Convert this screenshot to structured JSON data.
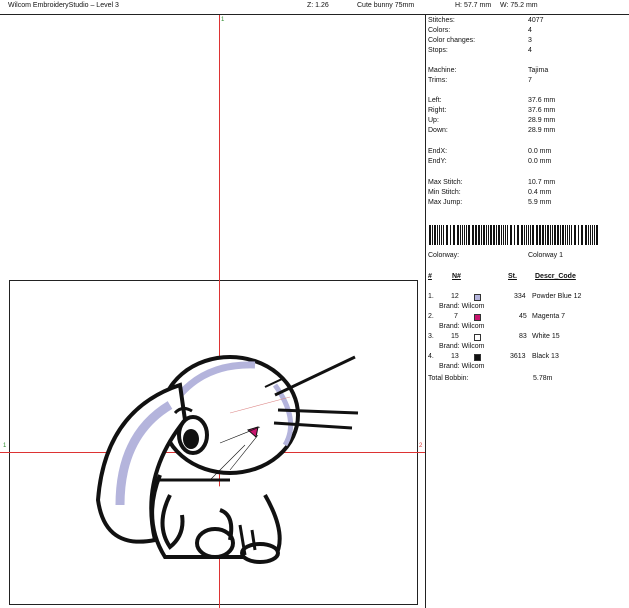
{
  "title_bar": {
    "app_title": "Wilcom EmbroideryStudio – Level 3",
    "zoom": "Z: 1.26",
    "design_name": "Cute bunny 75mm",
    "height_info": "H: 57.7 mm",
    "width_info": "W: 75.2 mm"
  },
  "canvas": {
    "top_marker": "1",
    "left_marker": "1",
    "right_marker": "2"
  },
  "summary": [
    {
      "label": "Stitches:",
      "value": "4077"
    },
    {
      "label": "Colors:",
      "value": "4"
    },
    {
      "label": "Color changes:",
      "value": "3"
    },
    {
      "label": "Stops:",
      "value": "4"
    },
    {
      "label": "Machine:",
      "value": "Tajima"
    },
    {
      "label": "Trims:",
      "value": "7"
    },
    {
      "label": "Left:",
      "value": "37.6 mm"
    },
    {
      "label": "Right:",
      "value": "37.6 mm"
    },
    {
      "label": "Up:",
      "value": "28.9 mm"
    },
    {
      "label": "Down:",
      "value": "28.9 mm"
    },
    {
      "label": "EndX:",
      "value": "0.0 mm"
    },
    {
      "label": "EndY:",
      "value": "0.0 mm"
    },
    {
      "label": "Max Stitch:",
      "value": "10.7 mm"
    },
    {
      "label": "Min Stitch:",
      "value": "0.4 mm"
    },
    {
      "label": "Max Jump:",
      "value": "5.9 mm"
    }
  ],
  "colorway": {
    "label": "Colorway:",
    "value": "Colorway 1"
  },
  "table": {
    "headers": {
      "num": "#",
      "needle": "N#",
      "stitches": "St.",
      "descr": "Descr_Code"
    },
    "rows": [
      {
        "num": "1.",
        "needle": "12",
        "color": "#b4b4dc",
        "stitches": "334",
        "descr": "Powder Blue 12",
        "brand": "Brand: Wilcom"
      },
      {
        "num": "2.",
        "needle": "7",
        "color": "#c8166e",
        "stitches": "45",
        "descr": "Magenta 7",
        "brand": "Brand: Wilcom"
      },
      {
        "num": "3.",
        "needle": "15",
        "color": "#ffffff",
        "stitches": "83",
        "descr": "White 15",
        "brand": "Brand: Wilcom"
      },
      {
        "num": "4.",
        "needle": "13",
        "color": "#111111",
        "stitches": "3613",
        "descr": "Black 13",
        "brand": "Brand: Wilcom"
      }
    ],
    "total_label": "Total Bobbin:",
    "total_value": "5.78m"
  }
}
